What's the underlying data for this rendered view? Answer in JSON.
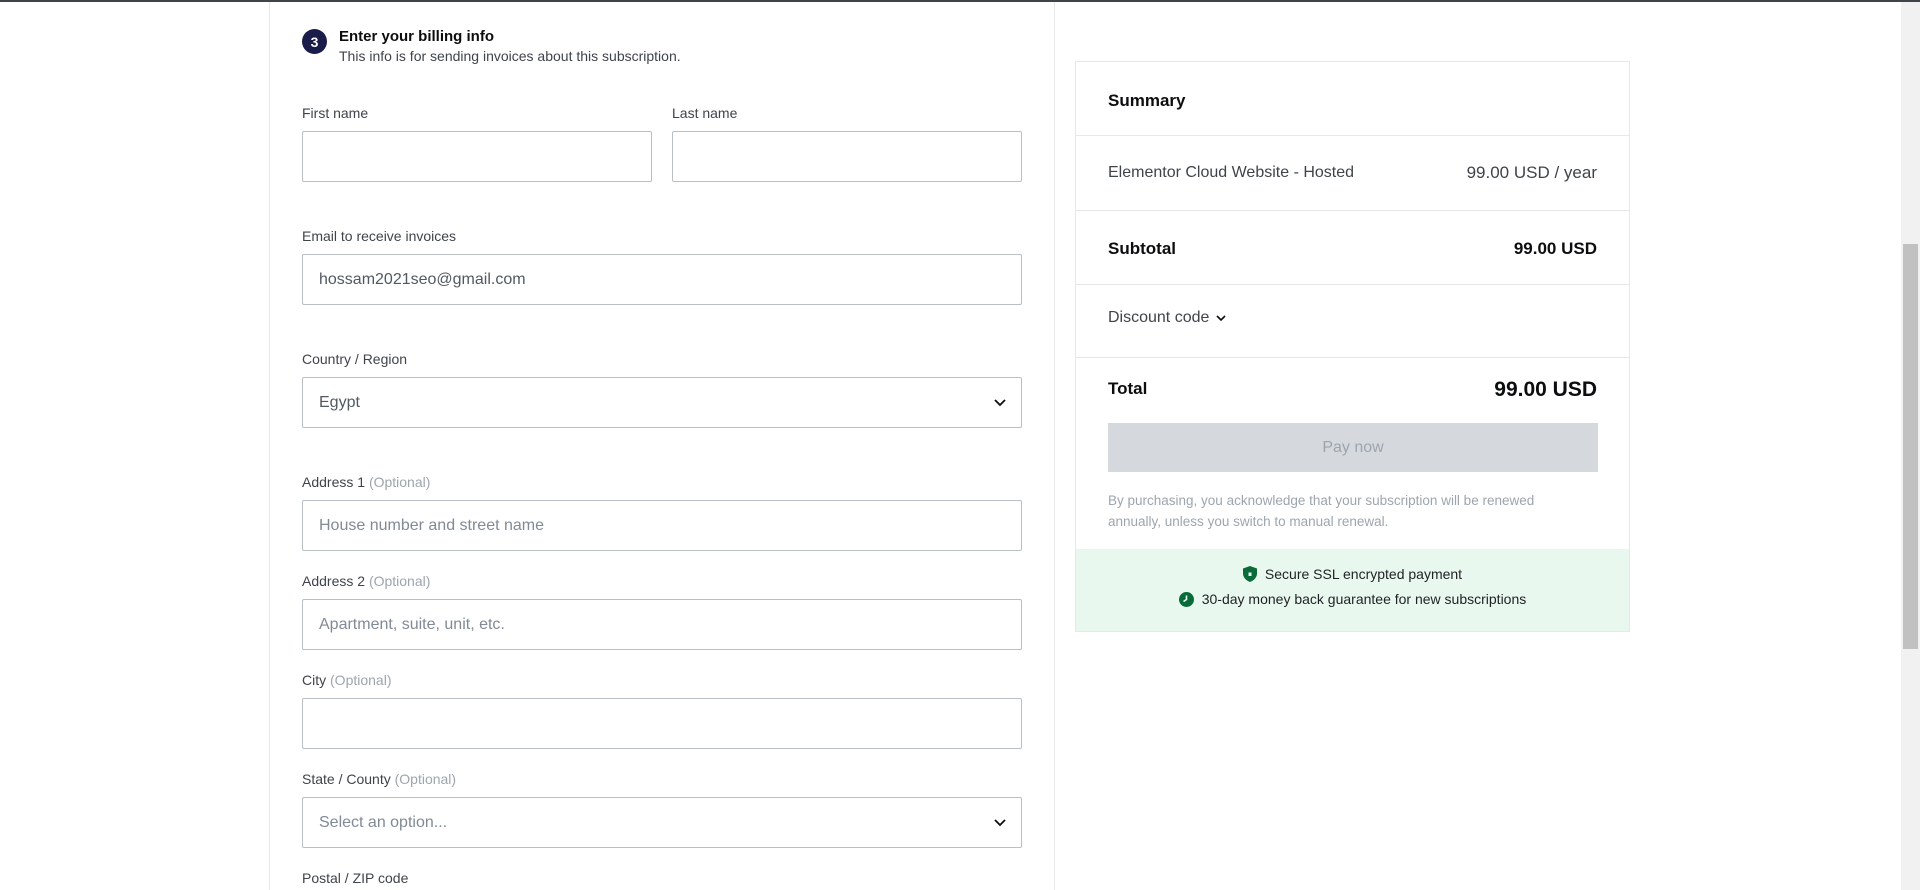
{
  "step": {
    "number": "3",
    "title": "Enter your billing info",
    "subtitle": "This info is for sending invoices about this subscription."
  },
  "form": {
    "first_name_label": "First name",
    "first_name_value": "",
    "last_name_label": "Last name",
    "last_name_value": "",
    "email_label": "Email to receive invoices",
    "email_value": "hossam2021seo@gmail.com",
    "country_label": "Country / Region",
    "country_value": "Egypt",
    "address1_label": "Address 1",
    "address1_optional": "(Optional)",
    "address1_placeholder": "House number and street name",
    "address2_label": "Address 2",
    "address2_optional": "(Optional)",
    "address2_placeholder": "Apartment, suite, unit, etc.",
    "city_label": "City",
    "city_optional": "(Optional)",
    "city_value": "",
    "state_label": "State / County",
    "state_optional": "(Optional)",
    "state_placeholder": "Select an option...",
    "postal_label": "Postal / ZIP code"
  },
  "summary": {
    "title": "Summary",
    "product_name": "Elementor Cloud Website - Hosted",
    "product_price": "99.00 USD / year",
    "subtotal_label": "Subtotal",
    "subtotal_value": "99.00 USD",
    "discount_label": "Discount code",
    "total_label": "Total",
    "total_value": "99.00 USD",
    "pay_button": "Pay now",
    "disclaimer": "By purchasing, you acknowledge that your subscription will be renewed annually, unless you switch to manual renewal.",
    "secure_text": "Secure SSL encrypted payment",
    "guarantee_text": "30-day money back guarantee for new subscriptions"
  },
  "icons": {
    "chevron": "chevron-down-icon",
    "shield": "shield-icon",
    "clock": "clock-icon"
  },
  "colors": {
    "accent": "#1a1c4a",
    "secure_bg": "#e8f8ee",
    "secure_icon": "#0a6b3a"
  }
}
